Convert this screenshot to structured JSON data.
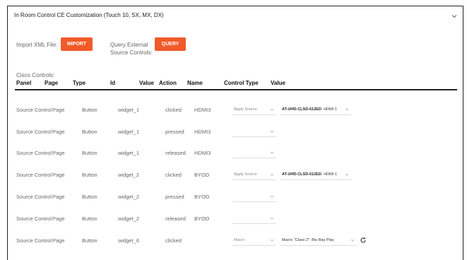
{
  "panel": {
    "title": "In Room Control CE Customization (Touch 10, SX, MX, DX)",
    "collapse_icon": "chevron-down-icon"
  },
  "import": {
    "label": "Import XML File:",
    "button": "IMPORT"
  },
  "query": {
    "label_line1": "Query External",
    "label_line2": "Source Controls:",
    "button": "QUERY"
  },
  "section_label": "Cisco Controls:",
  "columns": [
    "Panel",
    "Page",
    "Type",
    "Id",
    "Value",
    "Action",
    "Name",
    "Control Type",
    "Value"
  ],
  "rows": [
    {
      "panel": "Source Control",
      "page": "Page",
      "type": "Button",
      "id": "widget_1",
      "value": "",
      "action": "clicked",
      "name": "HDMI3",
      "control_type": "Apply Source",
      "value_bold": "AT-UHD-CLSD-612ED",
      "value_rest": "- HDMI 1"
    },
    {
      "panel": "Source Control",
      "page": "Page",
      "type": "Button",
      "id": "widget_1",
      "value": "",
      "action": "pressed",
      "name": "HDMI3",
      "control_type": "",
      "value_bold": "",
      "value_rest": ""
    },
    {
      "panel": "Source Control",
      "page": "Page",
      "type": "Button",
      "id": "widget_1",
      "value": "",
      "action": "released",
      "name": "HDMI3",
      "control_type": "",
      "value_bold": "",
      "value_rest": ""
    },
    {
      "panel": "Source Control",
      "page": "Page",
      "type": "Button",
      "id": "widget_2",
      "value": "",
      "action": "clicked",
      "name": "BYOD",
      "control_type": "Apply Source",
      "value_bold": "AT-UHD-CLSD-612ED",
      "value_rest": "- HDMI 1"
    },
    {
      "panel": "Source Control",
      "page": "Page",
      "type": "Button",
      "id": "widget_2",
      "value": "",
      "action": "pressed",
      "name": "BYOD",
      "control_type": "",
      "value_bold": "",
      "value_rest": ""
    },
    {
      "panel": "Source Control",
      "page": "Page",
      "type": "Button",
      "id": "widget_2",
      "value": "",
      "action": "released",
      "name": "BYOD",
      "control_type": "",
      "value_bold": "",
      "value_rest": ""
    },
    {
      "panel": "Source Control",
      "page": "Page",
      "type": "Button",
      "id": "widget_6",
      "value": "",
      "action": "clicked",
      "name": "",
      "control_type": "Macro",
      "value_bold": "",
      "value_rest": "Macro \"Class 2\": Blu Ray Play",
      "refresh_icon": "refresh-icon"
    }
  ],
  "colors": {
    "accent": "#f15a29",
    "border": "#222222",
    "muted_text": "#666666"
  }
}
